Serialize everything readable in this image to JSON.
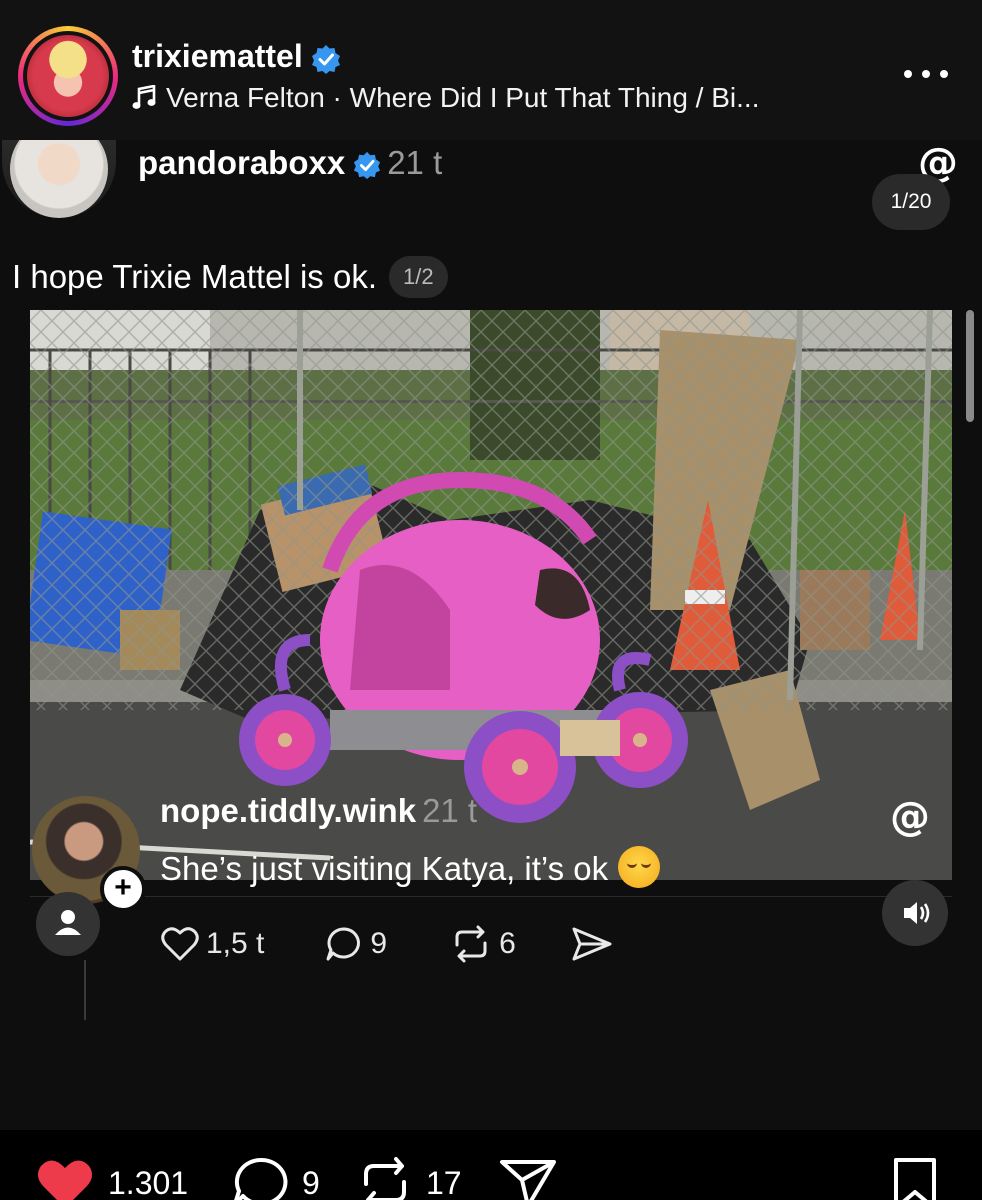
{
  "header": {
    "username": "trixiemattel",
    "music": "Verna Felton · Where Did I Put That Thing / Bi..."
  },
  "post": {
    "username": "pandoraboxx",
    "time": "21 t",
    "counter": "1/20",
    "text": "I hope Trixie Mattel is ok.",
    "page": "1/2"
  },
  "reply": {
    "username": "nope.tiddly.wink",
    "time": "21 t",
    "text": "She’s just visiting Katya, it’s ok",
    "likes": "1,5 t",
    "comments": "9",
    "reposts": "6"
  },
  "bottom_bar": {
    "likes": "1.301",
    "comments": "9",
    "reposts": "17"
  },
  "colors": {
    "like_red": "#ed3b4b",
    "verified_blue": "#3797f0",
    "carriage_pink": "#e65fc4",
    "carriage_purple": "#8c4fc6"
  },
  "icons": [
    "verified-icon",
    "music-note-icon",
    "more-icon",
    "threads-icon",
    "heart-icon",
    "comment-icon",
    "repost-icon",
    "share-icon",
    "bookmark-icon",
    "volume-icon",
    "person-icon"
  ]
}
